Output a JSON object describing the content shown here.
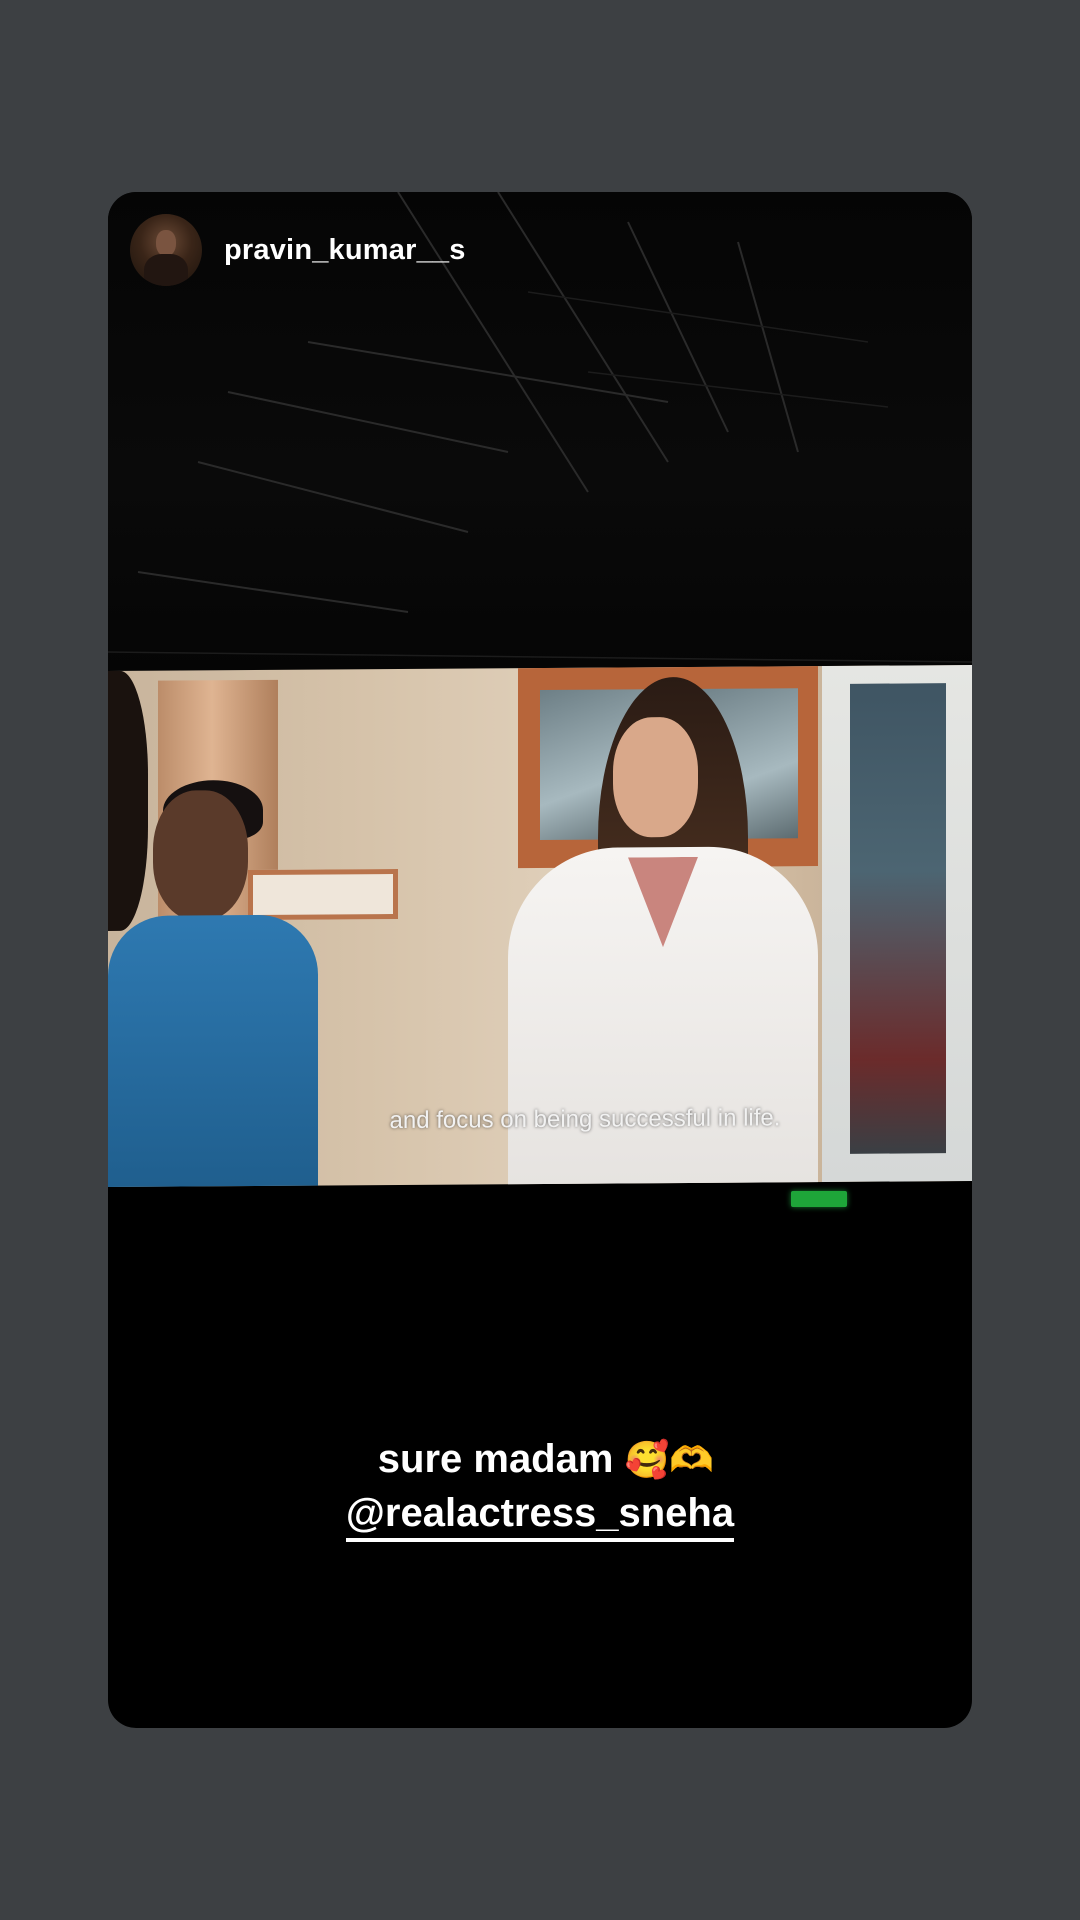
{
  "story": {
    "username": "pravin_kumar__s",
    "subtitle": "and focus on being successful in life.",
    "caption_text": "sure madam",
    "caption_emojis": "🥰🫶",
    "mention": "@realactress_sneha"
  },
  "colors": {
    "background": "#3d4043",
    "card": "#000000",
    "text": "#ffffff",
    "exit_sign": "#1ea539"
  },
  "icons": {
    "avatar": "profile-avatar"
  }
}
